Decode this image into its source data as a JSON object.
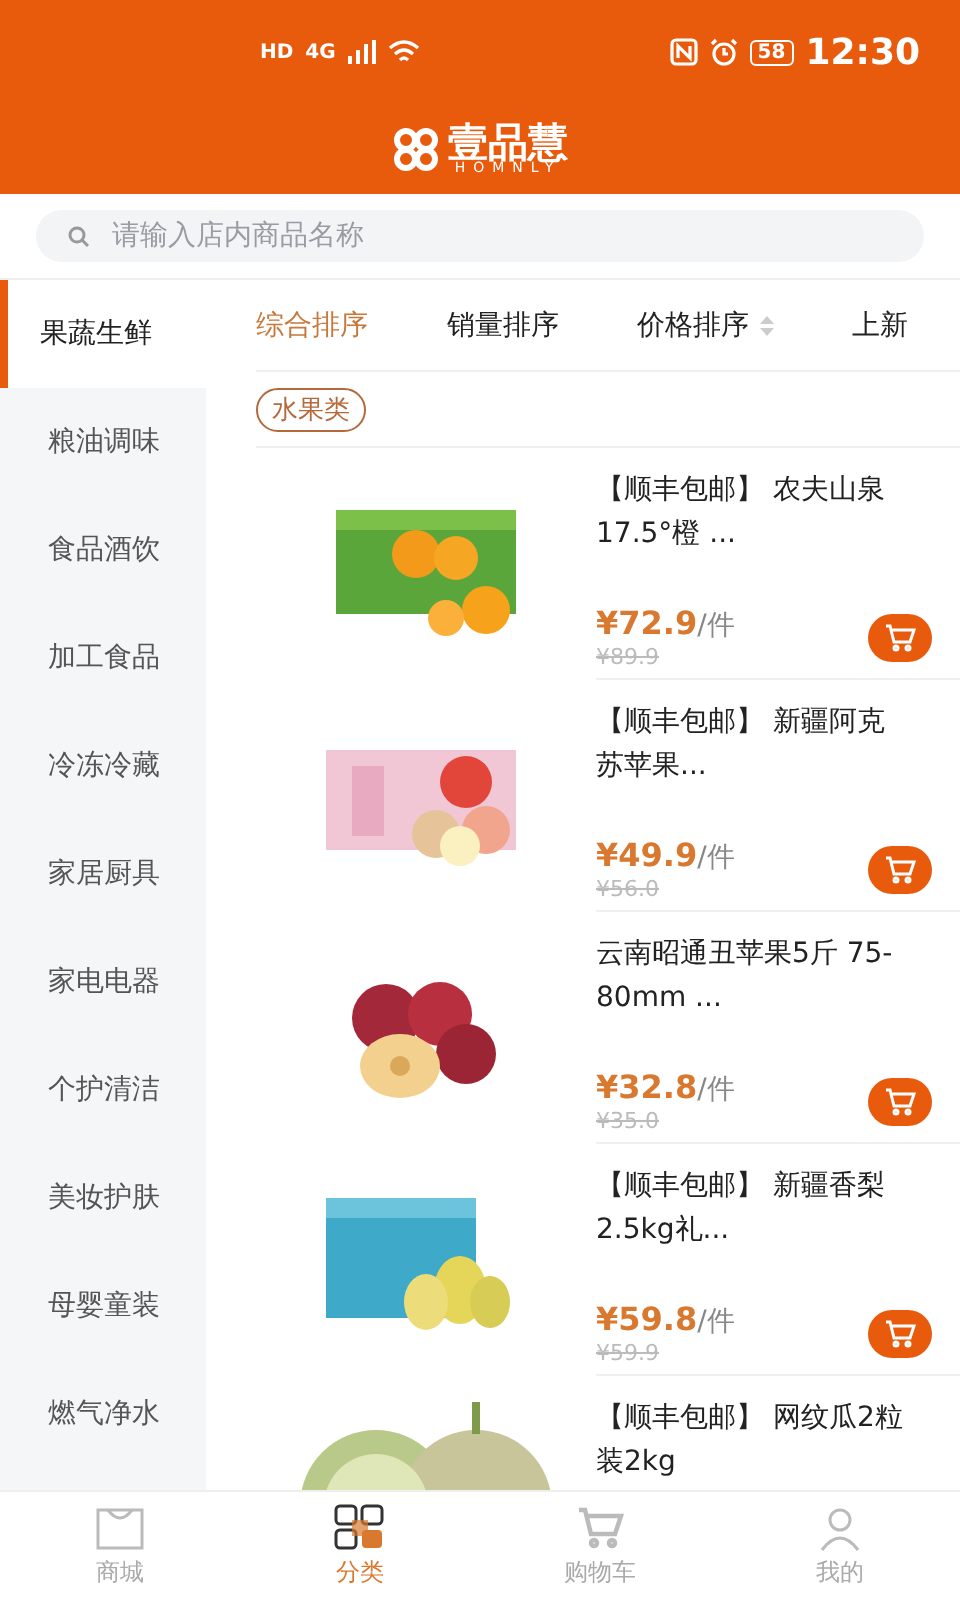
{
  "status_bar": {
    "left": [
      "HD",
      "4G"
    ],
    "battery": "58",
    "time": "12:30"
  },
  "header": {
    "logo_text": "壹品慧",
    "logo_subtext": "HOMNLY"
  },
  "search": {
    "placeholder": "请输入店内商品名称"
  },
  "sidebar": {
    "items": [
      {
        "label": "果蔬生鲜",
        "selected": true
      },
      {
        "label": "粮油调味",
        "selected": false
      },
      {
        "label": "食品酒饮",
        "selected": false
      },
      {
        "label": "加工食品",
        "selected": false
      },
      {
        "label": "冷冻冷藏",
        "selected": false
      },
      {
        "label": "家居厨具",
        "selected": false
      },
      {
        "label": "家电电器",
        "selected": false
      },
      {
        "label": "个护清洁",
        "selected": false
      },
      {
        "label": "美妆护肤",
        "selected": false
      },
      {
        "label": "母婴童装",
        "selected": false
      },
      {
        "label": "燃气净水",
        "selected": false
      }
    ]
  },
  "sort_tabs": [
    {
      "label": "综合排序",
      "selected": true,
      "sortable": false
    },
    {
      "label": "销量排序",
      "selected": false,
      "sortable": false
    },
    {
      "label": "价格排序",
      "selected": false,
      "sortable": true
    },
    {
      "label": "上新",
      "selected": false,
      "sortable": false
    }
  ],
  "tag": "水果类",
  "products": [
    {
      "title": "【顺丰包邮】 农夫山泉17.5°橙 ...",
      "price": "¥72.9",
      "unit": "/件",
      "original_price": "¥89.9",
      "kind": "orange"
    },
    {
      "title": "【顺丰包邮】 新疆阿克苏苹果...",
      "price": "¥49.9",
      "unit": "/件",
      "original_price": "¥56.0",
      "kind": "applebox"
    },
    {
      "title": "云南昭通丑苹果5斤 75-80mm ...",
      "price": "¥32.8",
      "unit": "/件",
      "original_price": "¥35.0",
      "kind": "apple"
    },
    {
      "title": "【顺丰包邮】 新疆香梨2.5kg礼...",
      "price": "¥59.8",
      "unit": "/件",
      "original_price": "¥59.9",
      "kind": "pear"
    },
    {
      "title": "【顺丰包邮】 网纹瓜2粒装2kg",
      "kind": "melon"
    }
  ],
  "bottom_nav": [
    {
      "label": "商城",
      "selected": false,
      "kind": "bag"
    },
    {
      "label": "分类",
      "selected": true,
      "kind": "grid"
    },
    {
      "label": "购物车",
      "selected": false,
      "kind": "cart"
    },
    {
      "label": "我的",
      "selected": false,
      "kind": "user"
    }
  ]
}
